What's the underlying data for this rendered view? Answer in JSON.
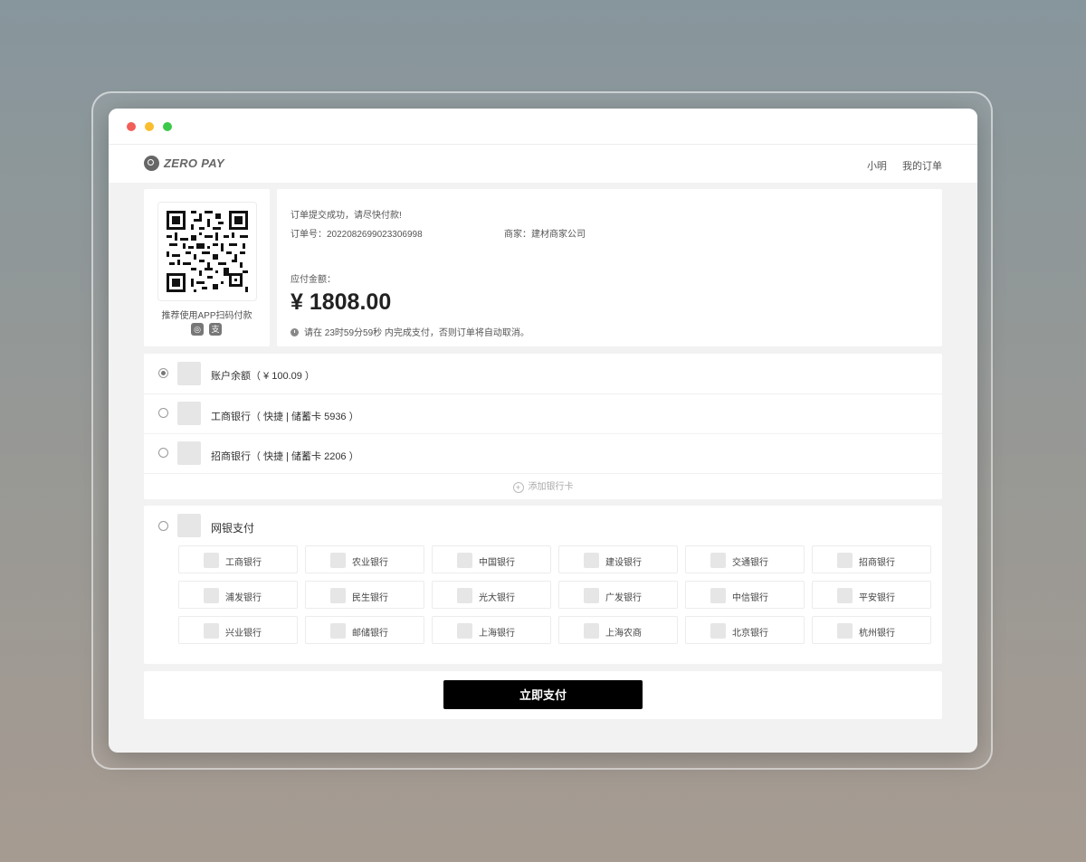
{
  "brand": {
    "name": "ZERO PAY"
  },
  "nav": {
    "user": "小明",
    "orders": "我的订单"
  },
  "qr": {
    "tip": "推荐使用APP扫码付款",
    "icons": [
      "wechat-icon",
      "alipay-icon"
    ]
  },
  "order": {
    "success_msg": "订单提交成功，请尽快付款!",
    "number_label": "订单号：2022082699023306998",
    "merchant_label": "商家：建材商家公司",
    "amount_label": "应付金额：",
    "amount": "¥ 1808.00",
    "deadline_note": "请在 23时59分59秒 内完成支付，否则订单将自动取消。"
  },
  "methods": [
    {
      "label": "账户余额（ ¥ 100.09 ）",
      "checked": true
    },
    {
      "label": "工商银行（ 快捷 | 储蓄卡 5936 ）",
      "checked": false
    },
    {
      "label": "招商银行（ 快捷 | 储蓄卡 2206 ）",
      "checked": false
    }
  ],
  "add_card": "添加银行卡",
  "netbank": {
    "title": "网银支付",
    "banks": [
      "工商银行",
      "农业银行",
      "中国银行",
      "建设银行",
      "交通银行",
      "招商银行",
      "浦发银行",
      "民生银行",
      "光大银行",
      "广发银行",
      "中信银行",
      "平安银行",
      "兴业银行",
      "邮储银行",
      "上海银行",
      "上海农商",
      "北京银行",
      "杭州银行"
    ]
  },
  "pay_button": "立即支付",
  "colors": {
    "accent": "#000000",
    "window_bg": "#f2f2f2",
    "card_bg": "#ffffff"
  }
}
